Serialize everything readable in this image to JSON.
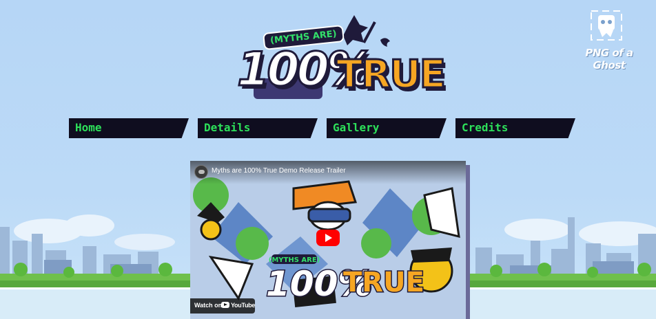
{
  "logo": {
    "badge": "(MYTHS ARE)",
    "number": "100%",
    "word": "TRUE"
  },
  "brand": {
    "name": "PNG of a Ghost"
  },
  "nav": {
    "items": [
      {
        "label": "Home"
      },
      {
        "label": "Details"
      },
      {
        "label": "Gallery"
      },
      {
        "label": "Credits"
      }
    ]
  },
  "video": {
    "title": "Myths are 100% True Demo Release Trailer",
    "watch_on": "Watch on",
    "platform": "YouTube",
    "thumb_badge": "(MYTHS ARE)",
    "thumb_number": "100%",
    "thumb_word": "TRUE"
  },
  "colors": {
    "sky": "#b6d6f6",
    "nav_bg": "#0f0d1f",
    "nav_text": "#2de05a",
    "logo_orange": "#f6a623",
    "logo_dark": "#1f1a3a",
    "play_red": "#ff0000"
  },
  "icons": {
    "brand": "ghost-icon",
    "play": "play-icon",
    "platform": "youtube-icon",
    "channel": "channel-avatar-icon"
  }
}
